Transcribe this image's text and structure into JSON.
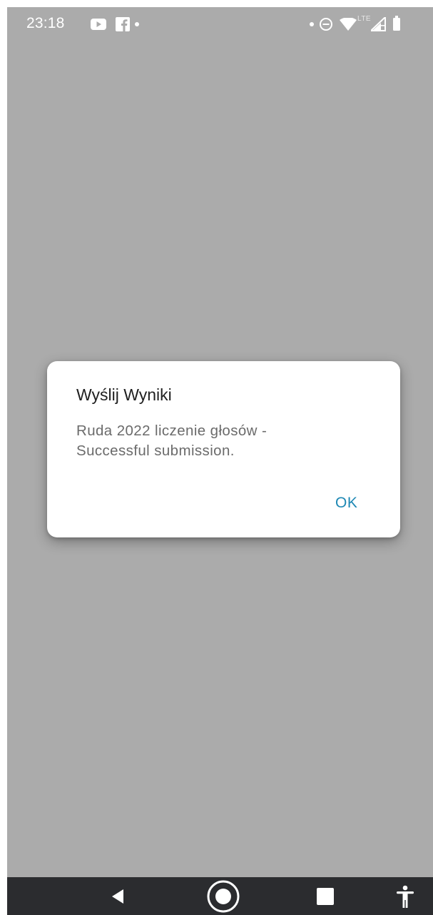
{
  "status_bar": {
    "time": "23:18",
    "network_label": "LTE",
    "left_icons": [
      "youtube-icon",
      "facebook-icon",
      "notification-dot-icon"
    ],
    "right_icons": [
      "notification-dot-icon",
      "do-not-disturb-icon",
      "wifi-icon",
      "signal-icon",
      "battery-icon"
    ]
  },
  "dialog": {
    "title": "Wyślij Wyniki",
    "message": "Ruda 2022 liczenie głosów  -\nSuccessful submission.",
    "ok_label": "OK"
  },
  "navigation_bar": {
    "buttons": [
      "back-icon",
      "home-icon",
      "recents-icon",
      "accessibility-icon"
    ]
  },
  "colors": {
    "scrim": "#ababab",
    "dialog_background": "#ffffff",
    "accent": "#1e88b4",
    "nav_bar": "#2b2c2f"
  }
}
